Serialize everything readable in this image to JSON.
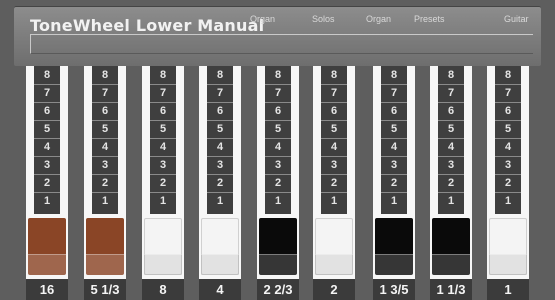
{
  "header": {
    "title": "ToneWheel Lower Manual",
    "nav": [
      "Organ",
      "Solos",
      "Organ",
      "Presets",
      "Guitar"
    ]
  },
  "colors": {
    "background": "#5e5e5e",
    "header": "#7b7b7b",
    "brown_knob": "#8a4526",
    "white_knob": "#f4f4f4",
    "black_knob": "#0a0a0a"
  },
  "scale_numbers": [
    "8",
    "7",
    "6",
    "5",
    "4",
    "3",
    "2",
    "1"
  ],
  "drawbars": [
    {
      "footage": "16",
      "color": "brown"
    },
    {
      "footage": "5 1/3",
      "color": "brown"
    },
    {
      "footage": "8",
      "color": "white"
    },
    {
      "footage": "4",
      "color": "white"
    },
    {
      "footage": "2 2/3",
      "color": "black"
    },
    {
      "footage": "2",
      "color": "white"
    },
    {
      "footage": "1 3/5",
      "color": "black"
    },
    {
      "footage": "1 1/3",
      "color": "black"
    },
    {
      "footage": "1",
      "color": "white"
    }
  ]
}
